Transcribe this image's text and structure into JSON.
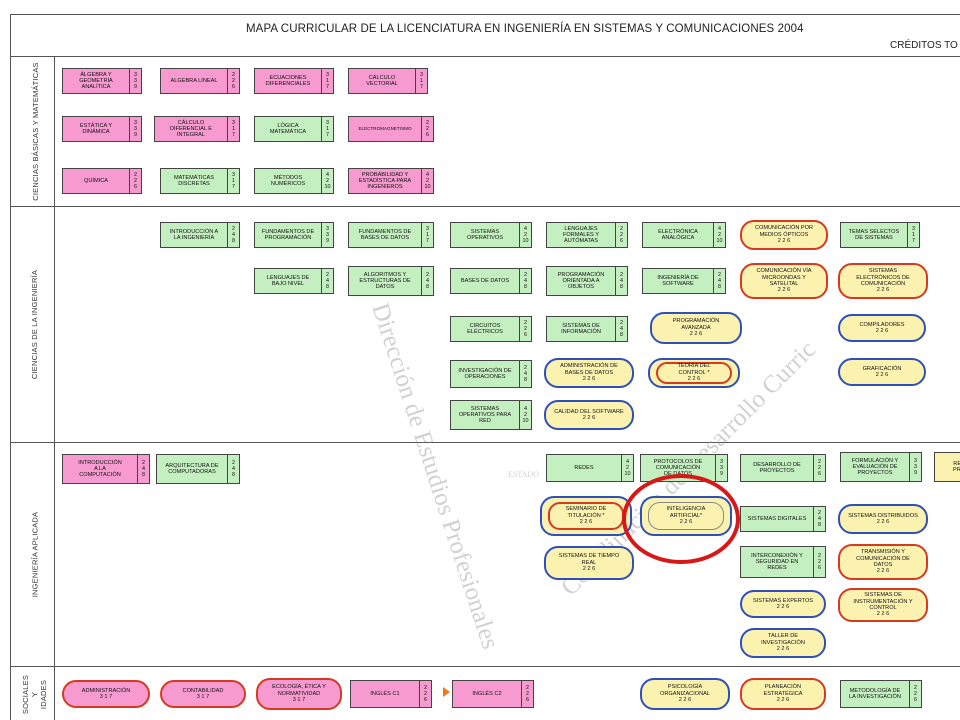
{
  "title": "MAPA CURRICULAR DE LA LICENCIATURA EN INGENIERÍA EN SISTEMAS Y COMUNICACIONES  2004",
  "credits_header": "CRÉDITOS TO",
  "rows": {
    "r1": "CIENCIAS BÁSICAS Y MATEMÁTICAS",
    "r2": "CIENCIAS DE LA INGENIERÍA",
    "r3": "INGENIERÍA APLICADA",
    "r4": "SOCIALES Y\nIDADES"
  },
  "cb": {
    "algebra_geo": {
      "name": "ÁLGEBRA Y\nGEOMETRÍA\nANALÍTICA",
      "cr": "3\n3\n9"
    },
    "algebra_lineal": {
      "name": "ALGEBRA LINEAL",
      "cr": "2\n2\n6"
    },
    "ecuaciones": {
      "name": "ECUACIONES\nDIFERENCIALES",
      "cr": "3\n1\n7"
    },
    "calculo_vectorial": {
      "name": "CÁLCULO\nVECTORIAL",
      "cr": "3\n1\n7"
    },
    "estatica": {
      "name": "ESTÁTICA Y\nDINÁMICA",
      "cr": "3\n3\n9"
    },
    "calculo_dif": {
      "name": "CÁLCULO\nDIFERENCIAL E\nINTEGRAL",
      "cr": "3\n1\n7"
    },
    "logica": {
      "name": "LÓGICA\nMATEMÁTICA",
      "cr": "3\n1\n7"
    },
    "electromag": {
      "name": "ELECTROMAGNETISMO",
      "cr": "2\n2\n6"
    },
    "quimica": {
      "name": "QUÍMICA",
      "cr": "2\n2\n6"
    },
    "mat_discretas": {
      "name": "MATEMÁTICAS\nDISCRETAS",
      "cr": "3\n1\n7"
    },
    "metodos_num": {
      "name": "MÉTODOS\nNUMÉRICOS",
      "cr": "4\n2\n10"
    },
    "probabilidad": {
      "name": "PROBABILIDAD Y\nESTADÍSTICA PARA\nINGENIEROS",
      "cr": "4\n2\n10"
    }
  },
  "ci": {
    "intro_ing": {
      "name": "INTRODUCCIÓN A\nLA INGENIERÍA",
      "cr": "2\n4\n8"
    },
    "fund_prog": {
      "name": "FUNDAMENTOS DE\nPROGRAMACIÓN",
      "cr": "3\n3\n9"
    },
    "fund_bd": {
      "name": "FUNDAMENTOS DE\nBASES DE DATOS",
      "cr": "3\n1\n7"
    },
    "sist_op": {
      "name": "SISTEMAS\nOPERATIVOS",
      "cr": "4\n2\n10"
    },
    "lenguajes_formales": {
      "name": "LENGUAJES\nFORMALES Y\nAUTÓMATAS",
      "cr": "2\n2\n6"
    },
    "electronica": {
      "name": "ELECTRÓNICA\nANALÓGICA",
      "cr": "4\n2\n10"
    },
    "comunic_optica": {
      "name": "COMUNICACIÓN POR\nMEDIOS ÓPTICOS\n2 2 6"
    },
    "temas_selectos": {
      "name": "TEMAS SELECTOS\nDE SISTEMAS",
      "cr": "3\n1\n7"
    },
    "leng_bajo": {
      "name": "LENGUAJES DE\nBAJO NIVEL",
      "cr": "2\n4\n8"
    },
    "algoritmos": {
      "name": "ALGORITMOS Y\nESTRUCTURAS DE\nDATOS",
      "cr": "2\n4\n8"
    },
    "bases_datos": {
      "name": "BASES DE DATOS",
      "cr": "2\n4\n8"
    },
    "poo": {
      "name": "PROGRAMACIÓN\nORIENTADA A\nOBJETOS",
      "cr": "2\n4\n8"
    },
    "ing_software": {
      "name": "INGENIERÍA DE\nSOFTWARE",
      "cr": "2\n4\n8"
    },
    "comunic_microondas": {
      "name": "COMUNICACIÓN VÍA\nMICROONDAS Y\nSATELITAL\n2 2 6"
    },
    "sist_electronicos": {
      "name": "SISTEMAS\nELECTRÓNICOS DE\nCOMUNICACIÓN\n2 2 6"
    },
    "circuitos": {
      "name": "CIRCUITOS\nELÉCTRICOS",
      "cr": "2\n2\n6"
    },
    "sist_informacion": {
      "name": "SISTEMAS DE\nINFORMACIÓN",
      "cr": "2\n4\n8"
    },
    "prog_avanzada": {
      "name": "PROGRAMACIÓN\nAVANZADA\n2 2 6"
    },
    "compiladores": {
      "name": "COMPILADORES\n2 2 6"
    },
    "investigacion_op": {
      "name": "INVESTIGACIÓN DE\nOPERACIONES",
      "cr": "2\n4\n8"
    },
    "admin_bd": {
      "name": "ADMINISTRACIÓN DE\nBASES DE DATOS\n2 2 6"
    },
    "teoria_control": {
      "name": "TEORÍA DEL\nCONTROL *\n2 2 6"
    },
    "graficacion": {
      "name": "GRAFICACIÓN\n2 2 6"
    },
    "sist_op_red": {
      "name": "SISTEMAS\nOPERATIVOS PARA\nRED",
      "cr": "4\n2\n10"
    },
    "calidad_software": {
      "name": "CALIDAD DEL SOFTWARE\n2 2 6"
    }
  },
  "ia": {
    "intro_comp": {
      "name": "INTRODUCCIÓN\nA LA\nCOMPUTACIÓN",
      "cr": "2\n4\n8"
    },
    "arq_comp": {
      "name": "ARQUITECTURA DE\nCOMPUTADORAS",
      "cr": "2\n4\n8"
    },
    "redes": {
      "name": "REDES",
      "cr": "4\n2\n10"
    },
    "protocolos": {
      "name": "PROTOCOLOS DE\nCOMUNICACIÓN\nDE DATOS",
      "cr": "3\n3\n9"
    },
    "desarrollo_proy": {
      "name": "DESARROLLO DE\nPROYECTOS",
      "cr": "2\n2\n6"
    },
    "formulacion": {
      "name": "FORMULACIÓN Y\nEVALUACIÓN DE\nPROYECTOS",
      "cr": "3\n3\n9"
    },
    "res_prof": {
      "name": "RES\nPRO"
    },
    "seminario": {
      "name": "SEMINARIO DE\nTITULACIÓN *\n2 2 6"
    },
    "inteligencia": {
      "name": "INTELIGENCIA ARTIFICIAL*\n2 2 6"
    },
    "sist_digitales": {
      "name": "SISTEMAS DIGITALES",
      "cr": "2\n4\n8"
    },
    "sist_distribuidos": {
      "name": "SISTEMAS DISTRIBUIDOS\n2 2 6"
    },
    "tiempo_real": {
      "name": "SISTEMAS DE TIEMPO\nREAL\n2 2 6"
    },
    "interconexion": {
      "name": "INTERCONEXIÓN Y\nSEGURIDAD EN\nREDES",
      "cr": "2\n2\n6"
    },
    "transmision": {
      "name": "TRANSMISIÓN Y\nCOMUNICACIÓN DE\nDATOS\n2 2 6"
    },
    "sist_expertos": {
      "name": "SISTEMAS EXPERTOS\n2 2 6"
    },
    "instrumentacion": {
      "name": "SISTEMAS DE\nINSTRUMENTACIÓN Y\nCONTROL\n2 2 6"
    },
    "taller_inv": {
      "name": "TALLER DE\nINVESTIGACIÓN\n2 2 6"
    }
  },
  "sh": {
    "administracion": {
      "name": "ADMINISTRACIÓN\n3 1 7"
    },
    "contabilidad": {
      "name": "CONTABILIDAD\n3 1 7"
    },
    "ecologia": {
      "name": "ECOLOGÍA, ÉTICA Y\nNORMATIVIDAD\n3 1 7"
    },
    "ingles1": {
      "name": "INGLÉS C1",
      "cr": "2\n2\n6"
    },
    "ingles2": {
      "name": "INGLÉS C2",
      "cr": "2\n2\n6"
    },
    "psicologia": {
      "name": "PSICOLOGÍA\nORGANIZACIONAL\n2 2 6"
    },
    "planeacion": {
      "name": "PLANEACIÓN\nESTRATÉGICA\n2 2 6"
    },
    "metodologia": {
      "name": "METODOLOGÍA DE\nLA INVESTIGACIÓN",
      "cr": "2\n2\n6"
    }
  },
  "watermark": {
    "a": "Dirección de Estudios Profesionales",
    "b": "Coordinación de Desarrollo Curric",
    "c": "ESTADO"
  }
}
